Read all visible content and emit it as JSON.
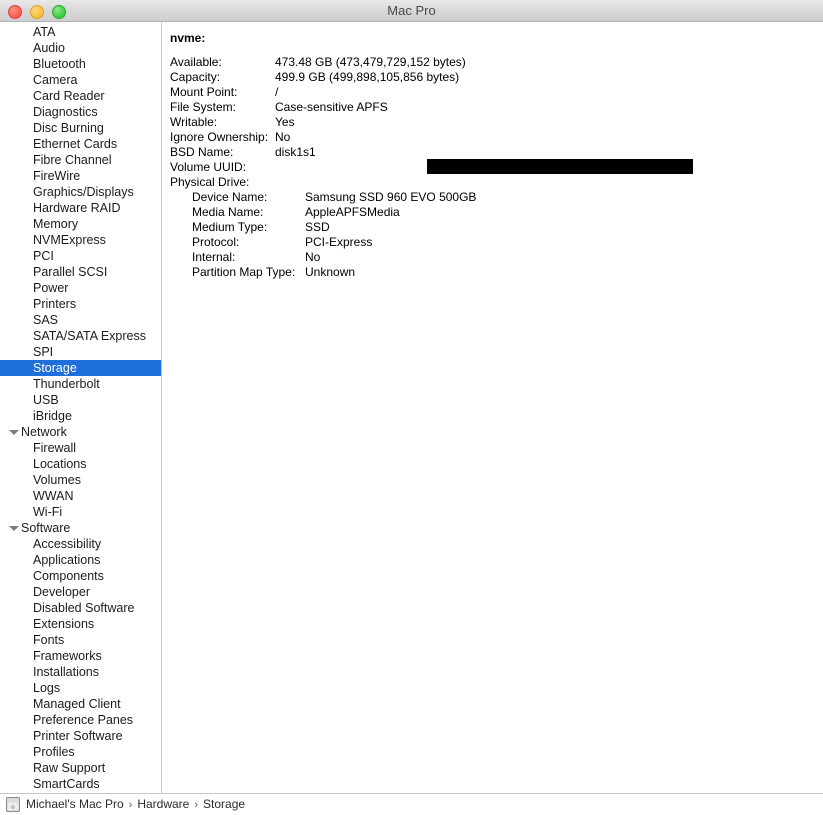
{
  "window": {
    "title": "Mac Pro",
    "traffic_lights": [
      "close-button",
      "minimize-button",
      "zoom-button"
    ]
  },
  "sidebar": {
    "items": [
      {
        "label": "ATA",
        "type": "leaf",
        "selected": false
      },
      {
        "label": "Audio",
        "type": "leaf",
        "selected": false
      },
      {
        "label": "Bluetooth",
        "type": "leaf",
        "selected": false
      },
      {
        "label": "Camera",
        "type": "leaf",
        "selected": false
      },
      {
        "label": "Card Reader",
        "type": "leaf",
        "selected": false
      },
      {
        "label": "Diagnostics",
        "type": "leaf",
        "selected": false
      },
      {
        "label": "Disc Burning",
        "type": "leaf",
        "selected": false
      },
      {
        "label": "Ethernet Cards",
        "type": "leaf",
        "selected": false
      },
      {
        "label": "Fibre Channel",
        "type": "leaf",
        "selected": false
      },
      {
        "label": "FireWire",
        "type": "leaf",
        "selected": false
      },
      {
        "label": "Graphics/Displays",
        "type": "leaf",
        "selected": false
      },
      {
        "label": "Hardware RAID",
        "type": "leaf",
        "selected": false
      },
      {
        "label": "Memory",
        "type": "leaf",
        "selected": false
      },
      {
        "label": "NVMExpress",
        "type": "leaf",
        "selected": false
      },
      {
        "label": "PCI",
        "type": "leaf",
        "selected": false
      },
      {
        "label": "Parallel SCSI",
        "type": "leaf",
        "selected": false
      },
      {
        "label": "Power",
        "type": "leaf",
        "selected": false
      },
      {
        "label": "Printers",
        "type": "leaf",
        "selected": false
      },
      {
        "label": "SAS",
        "type": "leaf",
        "selected": false
      },
      {
        "label": "SATA/SATA Express",
        "type": "leaf",
        "selected": false
      },
      {
        "label": "SPI",
        "type": "leaf",
        "selected": false
      },
      {
        "label": "Storage",
        "type": "leaf",
        "selected": true
      },
      {
        "label": "Thunderbolt",
        "type": "leaf",
        "selected": false
      },
      {
        "label": "USB",
        "type": "leaf",
        "selected": false
      },
      {
        "label": "iBridge",
        "type": "leaf",
        "selected": false
      },
      {
        "label": "Network",
        "type": "group",
        "selected": false
      },
      {
        "label": "Firewall",
        "type": "leaf",
        "selected": false
      },
      {
        "label": "Locations",
        "type": "leaf",
        "selected": false
      },
      {
        "label": "Volumes",
        "type": "leaf",
        "selected": false
      },
      {
        "label": "WWAN",
        "type": "leaf",
        "selected": false
      },
      {
        "label": "Wi-Fi",
        "type": "leaf",
        "selected": false
      },
      {
        "label": "Software",
        "type": "group",
        "selected": false
      },
      {
        "label": "Accessibility",
        "type": "leaf",
        "selected": false
      },
      {
        "label": "Applications",
        "type": "leaf",
        "selected": false
      },
      {
        "label": "Components",
        "type": "leaf",
        "selected": false
      },
      {
        "label": "Developer",
        "type": "leaf",
        "selected": false
      },
      {
        "label": "Disabled Software",
        "type": "leaf",
        "selected": false
      },
      {
        "label": "Extensions",
        "type": "leaf",
        "selected": false
      },
      {
        "label": "Fonts",
        "type": "leaf",
        "selected": false
      },
      {
        "label": "Frameworks",
        "type": "leaf",
        "selected": false
      },
      {
        "label": "Installations",
        "type": "leaf",
        "selected": false
      },
      {
        "label": "Logs",
        "type": "leaf",
        "selected": false
      },
      {
        "label": "Managed Client",
        "type": "leaf",
        "selected": false
      },
      {
        "label": "Preference Panes",
        "type": "leaf",
        "selected": false
      },
      {
        "label": "Printer Software",
        "type": "leaf",
        "selected": false
      },
      {
        "label": "Profiles",
        "type": "leaf",
        "selected": false
      },
      {
        "label": "Raw Support",
        "type": "leaf",
        "selected": false
      },
      {
        "label": "SmartCards",
        "type": "leaf",
        "selected": false
      }
    ],
    "selection_color": "#1e6fd9"
  },
  "detail": {
    "heading": "nvme:",
    "rows": [
      {
        "key": "Available:",
        "value": "473.48 GB (473,479,729,152 bytes)",
        "indent": 0,
        "redacted": false
      },
      {
        "key": "Capacity:",
        "value": "499.9 GB (499,898,105,856 bytes)",
        "indent": 0,
        "redacted": false
      },
      {
        "key": "Mount Point:",
        "value": "/",
        "indent": 0,
        "redacted": false
      },
      {
        "key": "File System:",
        "value": "Case-sensitive APFS",
        "indent": 0,
        "redacted": false
      },
      {
        "key": "Writable:",
        "value": "Yes",
        "indent": 0,
        "redacted": false
      },
      {
        "key": "Ignore Ownership:",
        "value": "No",
        "indent": 0,
        "redacted": false
      },
      {
        "key": "BSD Name:",
        "value": "disk1s1",
        "indent": 0,
        "redacted": false
      },
      {
        "key": "Volume UUID:",
        "value": "",
        "indent": 0,
        "redacted": true
      },
      {
        "key": "Physical Drive:",
        "value": "",
        "indent": 0,
        "redacted": false
      },
      {
        "key": "Device Name:",
        "value": "Samsung SSD 960 EVO 500GB",
        "indent": 1,
        "redacted": false
      },
      {
        "key": "Media Name:",
        "value": "AppleAPFSMedia",
        "indent": 1,
        "redacted": false
      },
      {
        "key": "Medium Type:",
        "value": "SSD",
        "indent": 1,
        "redacted": false
      },
      {
        "key": "Protocol:",
        "value": "PCI-Express",
        "indent": 1,
        "redacted": false
      },
      {
        "key": "Internal:",
        "value": "No",
        "indent": 1,
        "redacted": false
      },
      {
        "key": "Partition Map Type:",
        "value": "Unknown",
        "indent": 1,
        "redacted": false
      }
    ]
  },
  "statusbar": {
    "icon": "mac-pro-icon",
    "breadcrumb": [
      "Michael's Mac Pro",
      "Hardware",
      "Storage"
    ],
    "separator": "›"
  }
}
